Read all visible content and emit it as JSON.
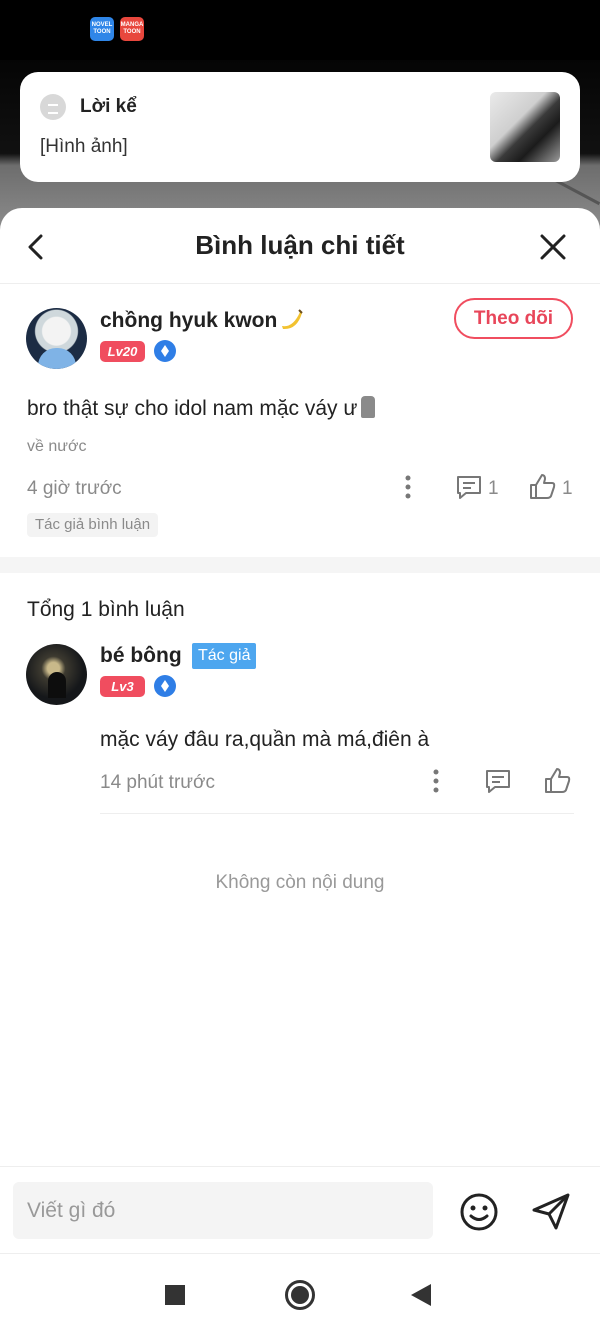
{
  "status_bar": {
    "app_icons": [
      {
        "name": "novel-toon-icon",
        "label": "NOVEL TOON",
        "color": "#2f86e8"
      },
      {
        "name": "manga-toon-icon",
        "label": "MANGA TOON",
        "color": "#e8473d"
      }
    ]
  },
  "story_card": {
    "title": "Lời kể",
    "subtitle": "[Hình ảnh]"
  },
  "sheet": {
    "title": "Bình luận chi tiết"
  },
  "main_comment": {
    "username": "chồng hyuk kwon",
    "level": "Lv20",
    "follow_label": "Theo dõi",
    "text": "bro thật sự cho idol nam mặc váy ư",
    "subtext": "về nước",
    "time": "4 giờ trước",
    "reply_count": "1",
    "like_count": "1",
    "tag": "Tác giả bình luận"
  },
  "replies": {
    "total_label": "Tổng 1 bình luận",
    "items": [
      {
        "username": "bé bông",
        "author_tag": "Tác giả",
        "level": "Lv3",
        "text": "mặc váy đâu ra,quần mà má,điên à",
        "time": "14 phút trước"
      }
    ],
    "end_label": "Không còn nội dung"
  },
  "input_bar": {
    "placeholder": "Viết gì đó"
  },
  "colors": {
    "accent": "#f04d5f",
    "author_tag": "#4da6ef",
    "vip_blue": "#2f7ee6",
    "muted_text": "#8a8a8a"
  }
}
